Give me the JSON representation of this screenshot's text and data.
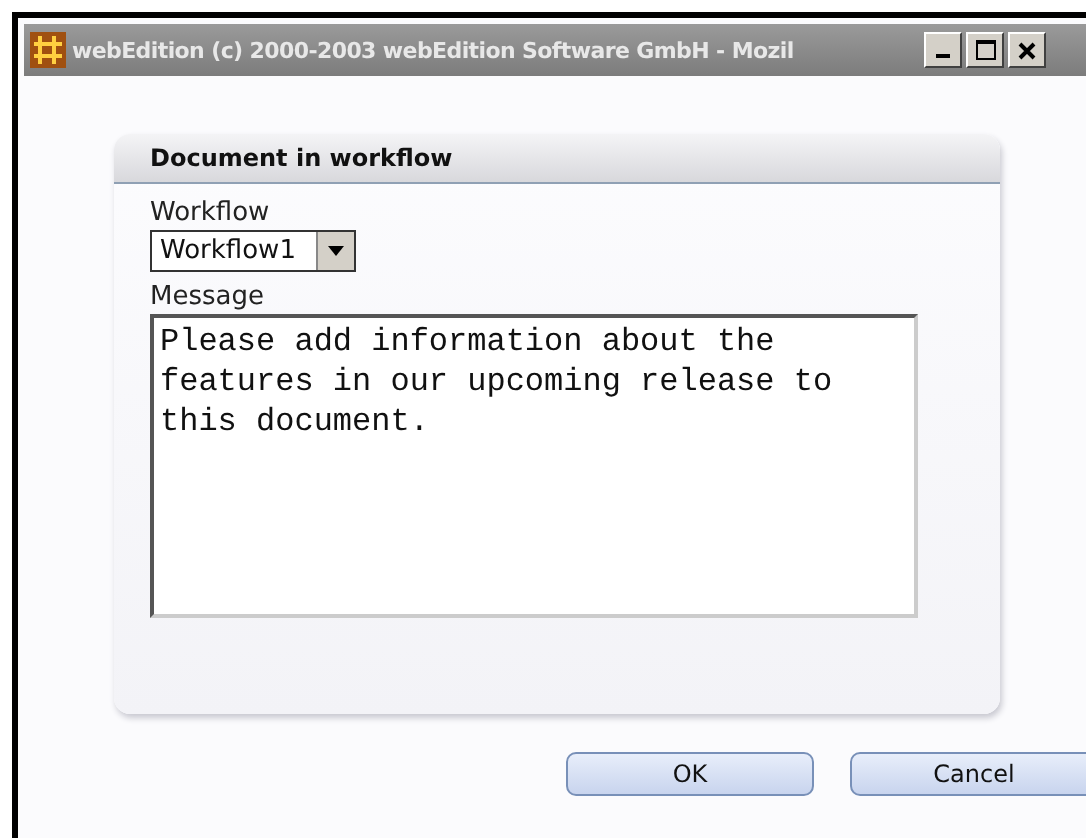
{
  "window": {
    "title": "webEdition (c) 2000-2003 webEdition Software GmbH - Mozil"
  },
  "dialog": {
    "title": "Document in workflow",
    "workflow": {
      "label": "Workflow",
      "value": "Workflow1"
    },
    "message": {
      "label": "Message",
      "value": "Please add information about the features in our upcoming release to this document."
    }
  },
  "buttons": [
    "OK",
    "Cancel"
  ]
}
